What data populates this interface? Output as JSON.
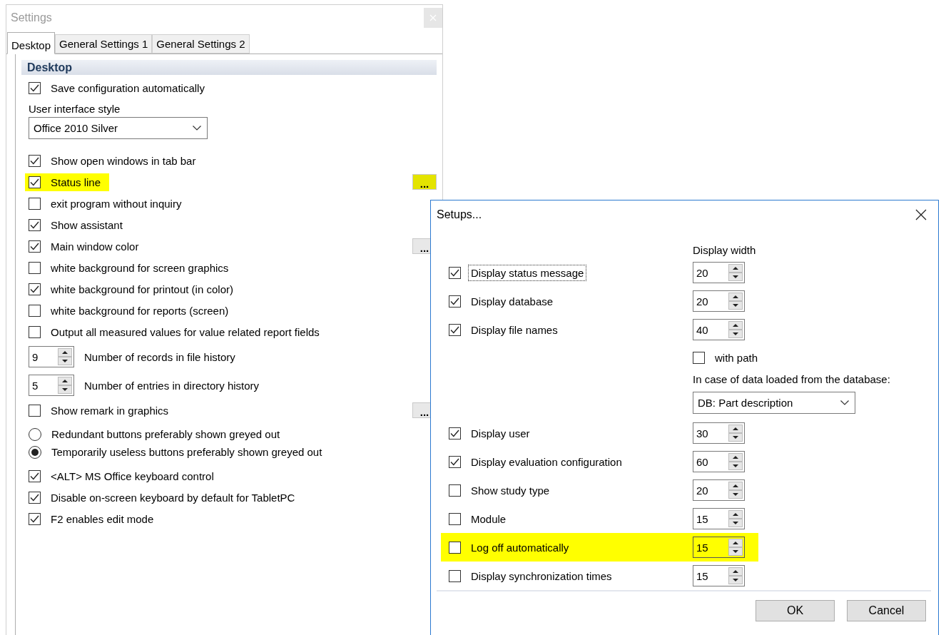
{
  "settings": {
    "title": "Settings",
    "tabs": [
      {
        "label": "Desktop",
        "selected": true
      },
      {
        "label": "General Settings 1",
        "selected": false
      },
      {
        "label": "General Settings 2",
        "selected": false
      }
    ],
    "section_header": "Desktop",
    "items": [
      {
        "kind": "checkbox",
        "label": "Save configuration automatically",
        "checked": true,
        "highlighted": false
      },
      {
        "kind": "caption",
        "label": "User interface style"
      },
      {
        "kind": "dropdown",
        "value": "Office 2010 Silver"
      },
      {
        "kind": "checkbox",
        "label": "Show open windows in tab bar",
        "checked": true,
        "highlighted": false
      },
      {
        "kind": "checkbox",
        "label": "Status line",
        "checked": true,
        "highlighted": true,
        "more_button": {
          "label": "...",
          "highlighted": true
        }
      },
      {
        "kind": "checkbox",
        "label": "exit program without inquiry",
        "checked": false,
        "highlighted": false
      },
      {
        "kind": "checkbox",
        "label": "Show assistant",
        "checked": true,
        "highlighted": false
      },
      {
        "kind": "checkbox",
        "label": "Main window color",
        "checked": true,
        "highlighted": false,
        "more_button": {
          "label": "...",
          "highlighted": false
        }
      },
      {
        "kind": "checkbox",
        "label": "white background for screen graphics",
        "checked": false,
        "highlighted": false
      },
      {
        "kind": "checkbox",
        "label": "white background for printout (in color)",
        "checked": true,
        "highlighted": false
      },
      {
        "kind": "checkbox",
        "label": "white background for reports (screen)",
        "checked": false,
        "highlighted": false
      },
      {
        "kind": "checkbox",
        "label": "Output all measured values for value related report fields",
        "checked": false,
        "highlighted": false
      },
      {
        "kind": "spinner",
        "value": "9",
        "label": "Number of records in file history"
      },
      {
        "kind": "spinner",
        "value": "5",
        "label": "Number of entries in directory history"
      },
      {
        "kind": "checkbox",
        "label": "Show remark in graphics",
        "checked": false,
        "highlighted": false,
        "more_button": {
          "label": "...",
          "highlighted": false
        }
      },
      {
        "kind": "radio",
        "label": "Redundant buttons preferably shown greyed out",
        "selected": false
      },
      {
        "kind": "radio",
        "label": "Temporarily useless buttons preferably shown greyed out",
        "selected": true
      },
      {
        "kind": "checkbox",
        "label": "<ALT> MS Office keyboard control",
        "checked": true,
        "highlighted": false
      },
      {
        "kind": "checkbox",
        "label": "Disable on-screen keyboard by default for TabletPC",
        "checked": true,
        "highlighted": false
      },
      {
        "kind": "checkbox",
        "label": "F2 enables edit mode",
        "checked": true,
        "highlighted": false
      }
    ]
  },
  "setups": {
    "title": "Setups...",
    "column_header": "Display width",
    "rows": [
      {
        "kind": "option",
        "label": "Display status message",
        "checked": true,
        "focused": true,
        "highlighted": false,
        "value": "20"
      },
      {
        "kind": "option",
        "label": "Display database",
        "checked": true,
        "focused": false,
        "highlighted": false,
        "value": "20"
      },
      {
        "kind": "option",
        "label": "Display file names",
        "checked": true,
        "focused": false,
        "highlighted": false,
        "value": "40"
      },
      {
        "kind": "subcheck",
        "label": "with path",
        "checked": false
      },
      {
        "kind": "caption",
        "label": "In case of data loaded from the database:"
      },
      {
        "kind": "dropdown",
        "value": "DB: Part description"
      },
      {
        "kind": "option",
        "label": "Display user",
        "checked": true,
        "focused": false,
        "highlighted": false,
        "value": "30"
      },
      {
        "kind": "option",
        "label": "Display evaluation configuration",
        "checked": true,
        "focused": false,
        "highlighted": false,
        "value": "60"
      },
      {
        "kind": "option",
        "label": "Show study type",
        "checked": false,
        "focused": false,
        "highlighted": false,
        "value": "20"
      },
      {
        "kind": "option",
        "label": "Module",
        "checked": false,
        "focused": false,
        "highlighted": false,
        "value": "15"
      },
      {
        "kind": "option",
        "label": "Log off automatically",
        "checked": false,
        "focused": false,
        "highlighted": true,
        "value": "15"
      },
      {
        "kind": "option",
        "label": "Display synchronization times",
        "checked": false,
        "focused": false,
        "highlighted": false,
        "value": "15"
      }
    ],
    "buttons": [
      "OK",
      "Cancel"
    ]
  }
}
